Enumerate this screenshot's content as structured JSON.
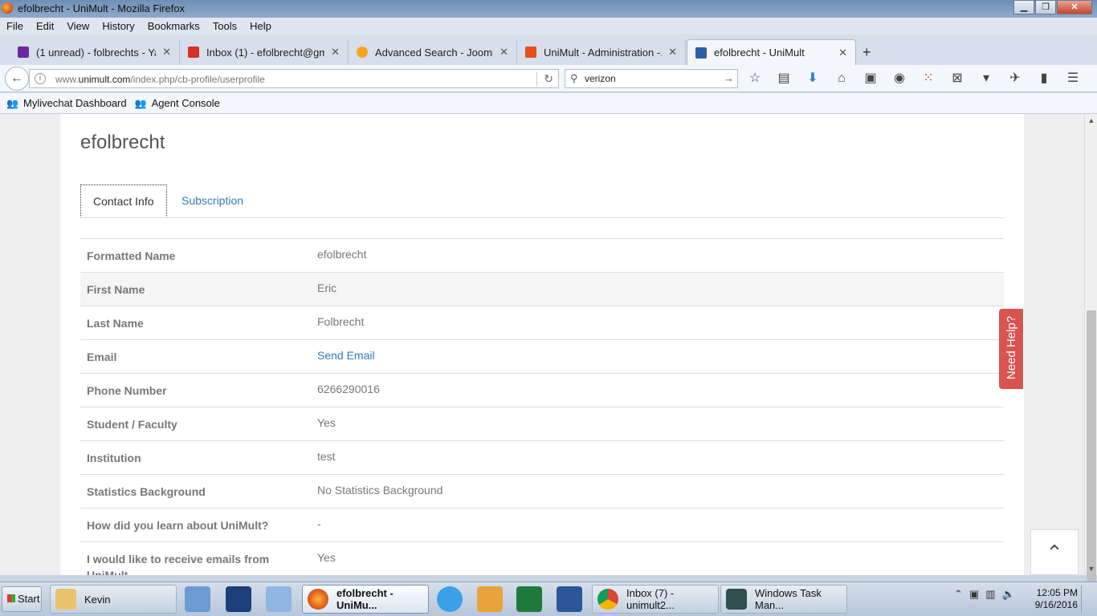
{
  "window": {
    "title": "efolbrecht - UniMult - Mozilla Firefox"
  },
  "menu": [
    "File",
    "Edit",
    "View",
    "History",
    "Bookmarks",
    "Tools",
    "Help"
  ],
  "tabs": [
    {
      "label": "(1 unread) - folbrechts - Ya...",
      "icon": "yahoo-mail-icon",
      "color": "#6b2aa3"
    },
    {
      "label": "Inbox (1) - efolbrecht@gm...",
      "icon": "gmail-icon",
      "color": "#d93025"
    },
    {
      "label": "Advanced Search - Joomla...",
      "icon": "joomla-icon",
      "color": "#f4a51c"
    },
    {
      "label": "UniMult - Administration -...",
      "icon": "joomla-admin-icon",
      "color": "#e94e1b"
    },
    {
      "label": "efolbrecht - UniMult",
      "icon": "unimult-icon",
      "color": "#2b5fa8"
    }
  ],
  "nav": {
    "url_host": "www.",
    "url_domain": "unimult.com",
    "url_path": "/index.php/cb-profile/userprofile",
    "search_value": "verizon"
  },
  "bookmarks": [
    "Mylivechat Dashboard",
    "Agent Console"
  ],
  "profile": {
    "username": "efolbrecht",
    "tabs": [
      "Contact Info",
      "Subscription"
    ],
    "rows": [
      {
        "key": "Formatted Name",
        "value": "efolbrecht"
      },
      {
        "key": "First Name",
        "value": "Eric"
      },
      {
        "key": "Last Name",
        "value": "Folbrecht"
      },
      {
        "key": "Email",
        "value": "Send Email"
      },
      {
        "key": "Phone Number",
        "value": "6266290016"
      },
      {
        "key": "Student / Faculty",
        "value": "Yes"
      },
      {
        "key": "Institution",
        "value": "test"
      },
      {
        "key": "Statistics Background",
        "value": "No Statistics Background"
      },
      {
        "key": "How did you learn about UniMult?",
        "value": "-"
      },
      {
        "key": "I would like to receive emails from UniMult",
        "value": "Yes"
      }
    ],
    "help_label": "Need Help?"
  },
  "taskbar": {
    "start": "Start",
    "items": [
      "Kevin",
      "efolbrecht - UniMu...",
      "Inbox (7) - unimult2...",
      "Windows Task Man..."
    ],
    "time": "12:05 PM",
    "date": "9/16/2016"
  }
}
